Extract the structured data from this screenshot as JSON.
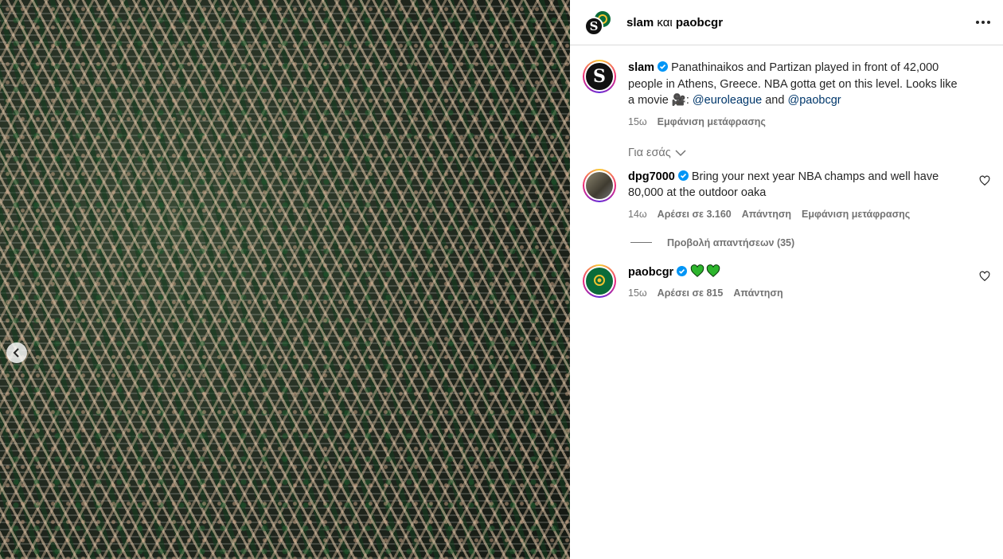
{
  "header": {
    "account1": "slam",
    "conjunction": "και",
    "account2": "paobcgr"
  },
  "post": {
    "username": "slam",
    "caption_part1": "Panathinaikos and Partizan played in front of 42,000 people in Athens, Greece. NBA gotta get on this level. Looks like a movie 🎥: ",
    "mention1": "@euroleague",
    "caption_and": " and ",
    "mention2": "@paobcgr",
    "time": "15ω",
    "translation": "Εμφάνιση μετάφρασης"
  },
  "for_you": "Για εσάς",
  "comments": [
    {
      "username": "dpg7000",
      "text": "Bring your next year NBA champs and well have 80,000 at the outdoor oaka",
      "time": "14ω",
      "likes": "Αρέσει σε 3.160",
      "reply": "Απάντηση",
      "translation": "Εμφάνιση μετάφρασης",
      "view_replies": "Προβολή απαντήσεων (35)"
    },
    {
      "username": "paobcgr",
      "time": "15ω",
      "likes": "Αρέσει σε 815",
      "reply": "Απάντηση"
    }
  ],
  "colors": {
    "verified": "#0095f6",
    "mention": "#00376b",
    "muted": "#737373",
    "heart_emoji": "#2db52d"
  },
  "icons": [
    "chevron-left-icon",
    "more-icon",
    "verified-icon",
    "chevron-down-icon",
    "heart-icon",
    "green-heart-icon"
  ]
}
